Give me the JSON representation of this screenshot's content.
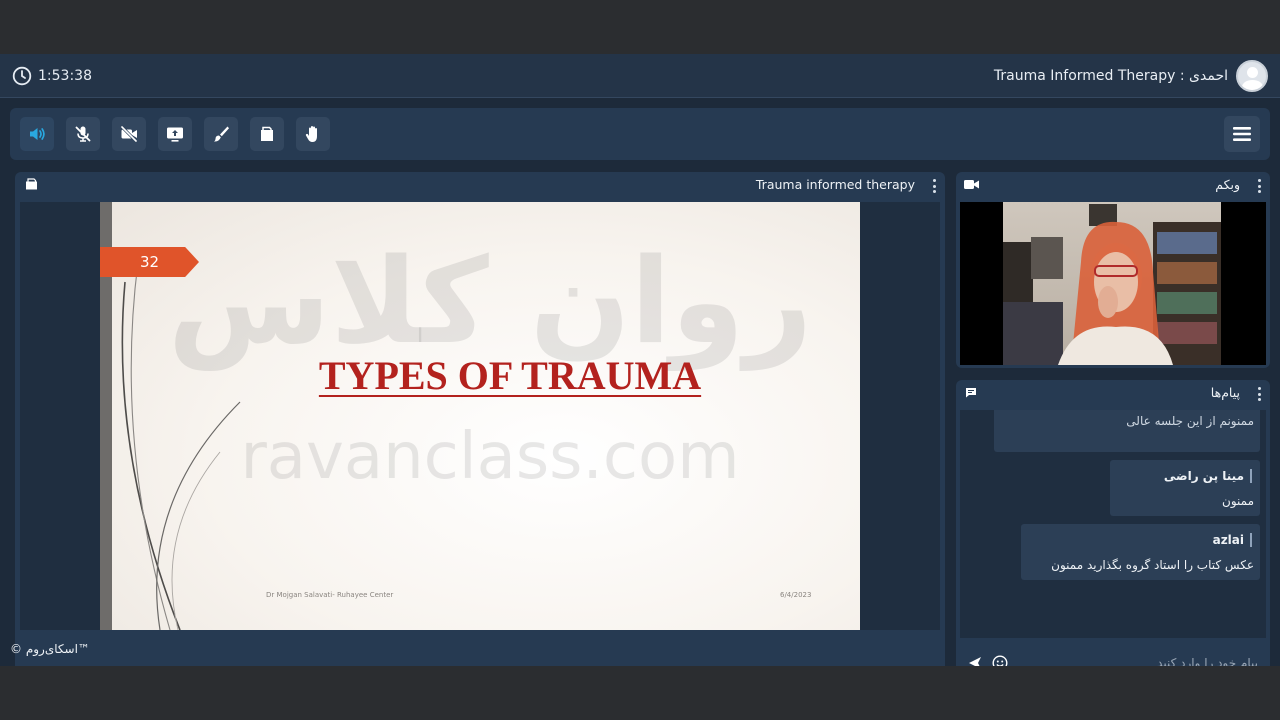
{
  "header": {
    "clock": "1:53:38",
    "session_title": "Trauma Informed Therapy : احمدی"
  },
  "toolbar": {
    "tools": [
      "speaker-icon",
      "mic-off-icon",
      "camera-off-icon",
      "screen-share-icon",
      "brush-icon",
      "file-icon",
      "hand-icon"
    ],
    "menu": "hamburger-icon"
  },
  "presentation": {
    "panel_title": "Trauma informed therapy",
    "slide": {
      "number": "32",
      "title": "TYPES OF TRAUMA",
      "watermark_fa": "روان کلاس",
      "watermark_en": "ravanclass.com",
      "footer_left": "Dr Mojgan Salavati- Ruhayee Center",
      "footer_right": "6/4/2023"
    }
  },
  "webcam": {
    "panel_title": "وبکم"
  },
  "chat": {
    "panel_title": "پیام‌ها",
    "messages": [
      {
        "name": "",
        "text": "ممنونم از این جلسه عالی"
      },
      {
        "name": "مینا پن راضی",
        "text": "ممنون"
      },
      {
        "name": "azlai",
        "text": "عکس کتاب را استاد گروه بگذارید ممنون"
      }
    ],
    "input_placeholder": "پیام خود را وارد کنید"
  },
  "footer": {
    "brand": "© اسکای‌روم™"
  },
  "colors": {
    "app_bg": "#1d2a3a",
    "panel_bg": "#263a52",
    "accent": "#29a8e0",
    "slide_title": "#b3221e",
    "slide_number_bg": "#e0542a"
  }
}
